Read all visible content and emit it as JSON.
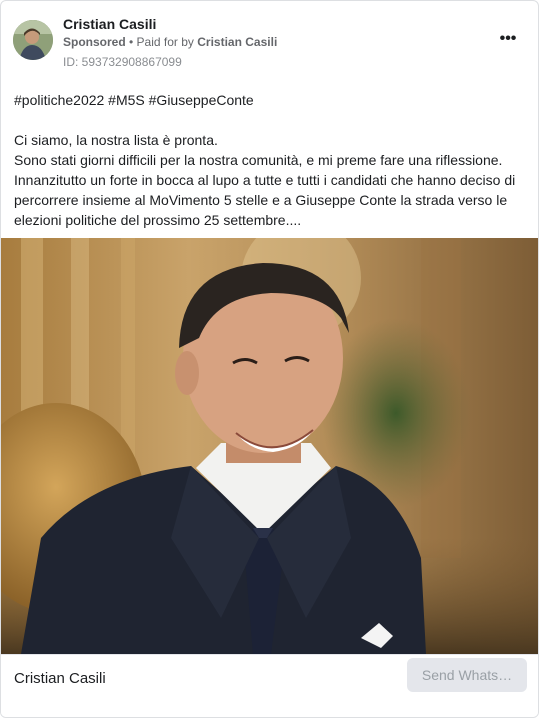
{
  "post": {
    "page_name": "Cristian Casili",
    "sponsored_label": "Sponsored",
    "separator": " • ",
    "paid_for_prefix": "Paid for by ",
    "paid_for_name": "Cristian Casili",
    "ad_id": "ID: 593732908867099",
    "more_icon": "more-options-icon",
    "hashtags": "#politiche2022 #M5S #GiuseppeConte",
    "lines": [
      "Ci siamo, la nostra lista è pronta.",
      "Sono stati giorni difficili per la nostra comunità, e mi preme fare una riflessione.",
      "Innanzitutto un forte in bocca al lupo a tutte e tutti i candidati che hanno deciso di",
      "percorrere insieme al MoVimento 5 stelle e a Giuseppe Conte la strada verso le",
      "elezioni politiche del prossimo 25 settembre...."
    ]
  },
  "footer": {
    "page_name": "Cristian Casili",
    "cta_label": "Send Whats…"
  },
  "colors": {
    "text": "#1c1e21",
    "secondary": "#65676b",
    "cta_bg": "#e4e6eb",
    "cta_text": "#9aa0a6"
  }
}
